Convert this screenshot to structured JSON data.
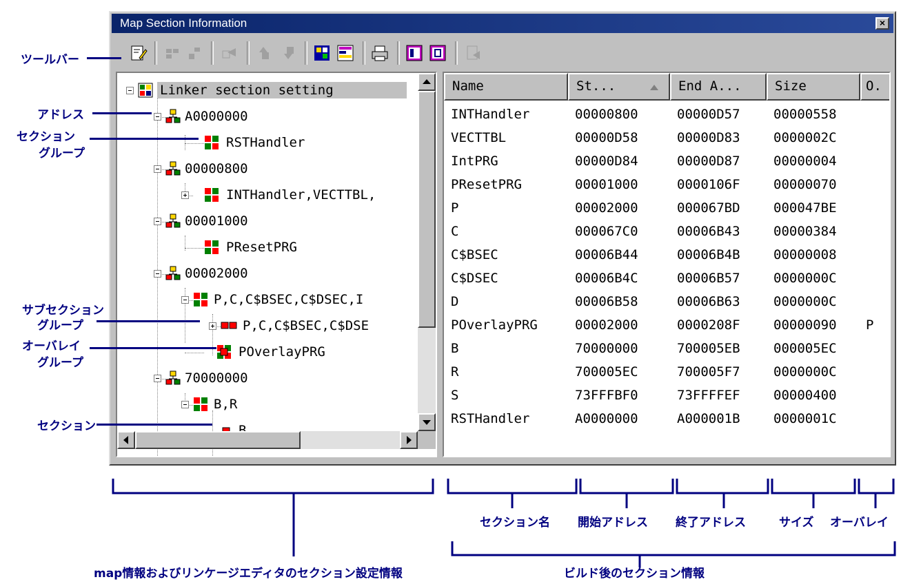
{
  "window": {
    "title": "Map Section Information",
    "close_glyph": "×"
  },
  "tree": {
    "root": "Linker section setting",
    "nodes": [
      "A0000000",
      "RSTHandler",
      "00000800",
      "INTHandler,VECTTBL,",
      "00001000",
      "PResetPRG",
      "00002000",
      "P,C,C$BSEC,C$DSEC,I",
      "P,C,C$BSEC,C$DSE",
      "POverlayPRG",
      "70000000",
      "B,R",
      "B"
    ]
  },
  "list": {
    "columns": [
      "Name",
      "St...",
      "End A...",
      "Size",
      "O."
    ],
    "rows": [
      [
        "INTHandler",
        "00000800",
        "00000D57",
        "00000558",
        ""
      ],
      [
        "VECTTBL",
        "00000D58",
        "00000D83",
        "0000002C",
        ""
      ],
      [
        "IntPRG",
        "00000D84",
        "00000D87",
        "00000004",
        ""
      ],
      [
        "PResetPRG",
        "00001000",
        "0000106F",
        "00000070",
        ""
      ],
      [
        "P",
        "00002000",
        "000067BD",
        "000047BE",
        ""
      ],
      [
        "C",
        "000067C0",
        "00006B43",
        "00000384",
        ""
      ],
      [
        "C$BSEC",
        "00006B44",
        "00006B4B",
        "00000008",
        ""
      ],
      [
        "C$DSEC",
        "00006B4C",
        "00006B57",
        "0000000C",
        ""
      ],
      [
        "D",
        "00006B58",
        "00006B63",
        "0000000C",
        ""
      ],
      [
        "POverlayPRG",
        "00002000",
        "0000208F",
        "00000090",
        "P"
      ],
      [
        "B",
        "70000000",
        "700005EB",
        "000005EC",
        ""
      ],
      [
        "R",
        "700005EC",
        "700005F7",
        "0000000C",
        ""
      ],
      [
        "S",
        "73FFFBF0",
        "73FFFFEF",
        "00000400",
        ""
      ],
      [
        "RSTHandler",
        "A0000000",
        "A000001B",
        "0000001C",
        ""
      ]
    ]
  },
  "annotations": {
    "toolbar": "ツールバー",
    "address": "アドレス",
    "section_group_1": "セクション",
    "section_group_2": "グループ",
    "subsection_1": "サブセクション",
    "subsection_2": "グループ",
    "overlay_1": "オーバレイ",
    "overlay_2": "グループ",
    "section": "セクション",
    "col_name": "セクション名",
    "col_start": "開始アドレス",
    "col_end": "終了アドレス",
    "col_size": "サイズ",
    "col_overlay": "オーバレイ",
    "left_caption": "map情報およびリンケージエディタのセクション設定情報",
    "right_caption": "ビルド後のセクション情報"
  }
}
